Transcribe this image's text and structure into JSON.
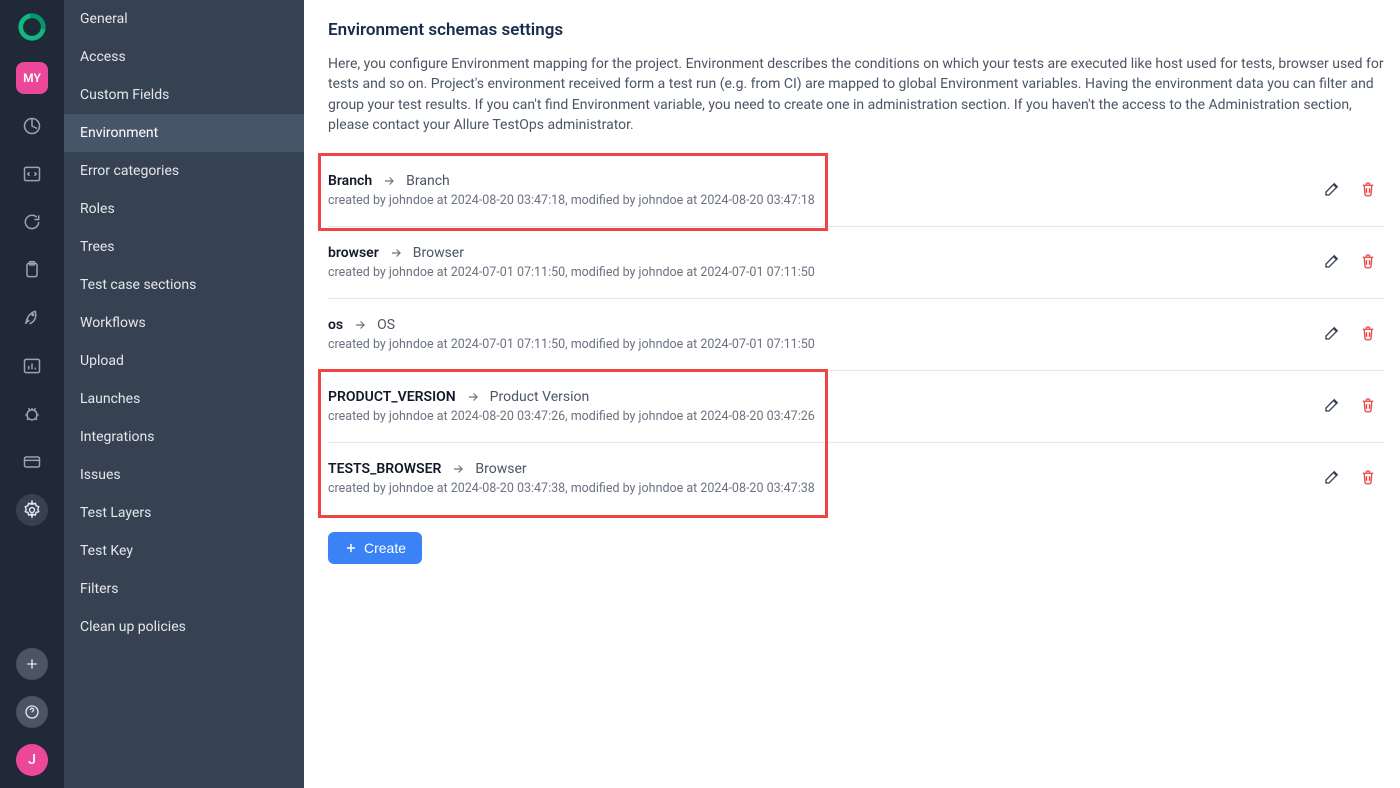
{
  "rail": {
    "project_badge": "MY",
    "user_initial": "J"
  },
  "nav": {
    "items": [
      "General",
      "Access",
      "Custom Fields",
      "Environment",
      "Error categories",
      "Roles",
      "Trees",
      "Test case sections",
      "Workflows",
      "Upload",
      "Launches",
      "Integrations",
      "Issues",
      "Test Layers",
      "Test Key",
      "Filters",
      "Clean up policies"
    ],
    "active_index": 3
  },
  "page": {
    "title": "Environment schemas settings",
    "description": "Here, you configure Environment mapping for the project. Environment describes the conditions on which your tests are executed like host used for tests, browser used for tests and so on. Project's environment received form a test run (e.g. from CI) are mapped to global Environment variables. Having the environment data you can filter and group your test results. If you can't find Environment variable, you need to create one in administration section. If you haven't the access to the Administration section, please contact your Allure TestOps administrator.",
    "create_label": "Create"
  },
  "schemas": [
    {
      "key": "Branch",
      "value": "Branch",
      "meta": "created by johndoe at 2024-08-20 03:47:18, modified by johndoe at 2024-08-20 03:47:18",
      "highlighted": true
    },
    {
      "key": "browser",
      "value": "Browser",
      "meta": "created by johndoe at 2024-07-01 07:11:50, modified by johndoe at 2024-07-01 07:11:50",
      "highlighted": false
    },
    {
      "key": "os",
      "value": "OS",
      "meta": "created by johndoe at 2024-07-01 07:11:50, modified by johndoe at 2024-07-01 07:11:50",
      "highlighted": false
    },
    {
      "key": "PRODUCT_VERSION",
      "value": "Product Version",
      "meta": "created by johndoe at 2024-08-20 03:47:26, modified by johndoe at 2024-08-20 03:47:26",
      "highlighted": true
    },
    {
      "key": "TESTS_BROWSER",
      "value": "Browser",
      "meta": "created by johndoe at 2024-08-20 03:47:38, modified by johndoe at 2024-08-20 03:47:38",
      "highlighted": true
    }
  ]
}
